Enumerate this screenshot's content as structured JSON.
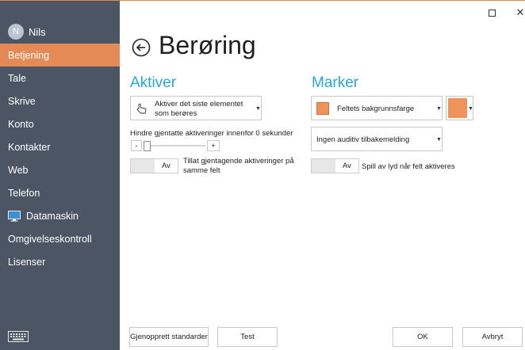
{
  "user": {
    "initial": "N",
    "name": "Nils"
  },
  "sidebar": {
    "items": [
      {
        "label": "Betjening"
      },
      {
        "label": "Tale"
      },
      {
        "label": "Skrive"
      },
      {
        "label": "Konto"
      },
      {
        "label": "Kontakter"
      },
      {
        "label": "Web"
      },
      {
        "label": "Telefon"
      },
      {
        "label": "Datamaskin"
      },
      {
        "label": "Omgivelseskontroll"
      },
      {
        "label": "Lisenser"
      }
    ]
  },
  "titlebar": {
    "maximize": "☐",
    "close": "✕"
  },
  "page": {
    "title": "Berøring"
  },
  "aktiver": {
    "title": "Aktiver",
    "activation_mode": {
      "line1": "Aktiver det siste elementet",
      "line2": "som berøres"
    },
    "repeat_label": "Hindre gjentatte aktiveringer innenfor 0 sekunder",
    "stepper": {
      "minus": "-",
      "plus": "+",
      "value_seconds": 0
    },
    "toggle": {
      "state": "Av",
      "line1": "Tillat gjentagende aktiveringer på",
      "line2": "samme felt"
    }
  },
  "marker": {
    "title": "Marker",
    "highlight_mode": "Feltets bakgrunnsfarge",
    "color": "#f0935a",
    "feedback": "Ingen auditiv tilbakemelding",
    "toggle": {
      "state": "Av",
      "label": "Spill av lyd når felt aktiveres"
    }
  },
  "footer": {
    "restore": "Gjenopprett standarder",
    "test": "Test",
    "ok": "OK",
    "cancel": "Avbryt"
  }
}
